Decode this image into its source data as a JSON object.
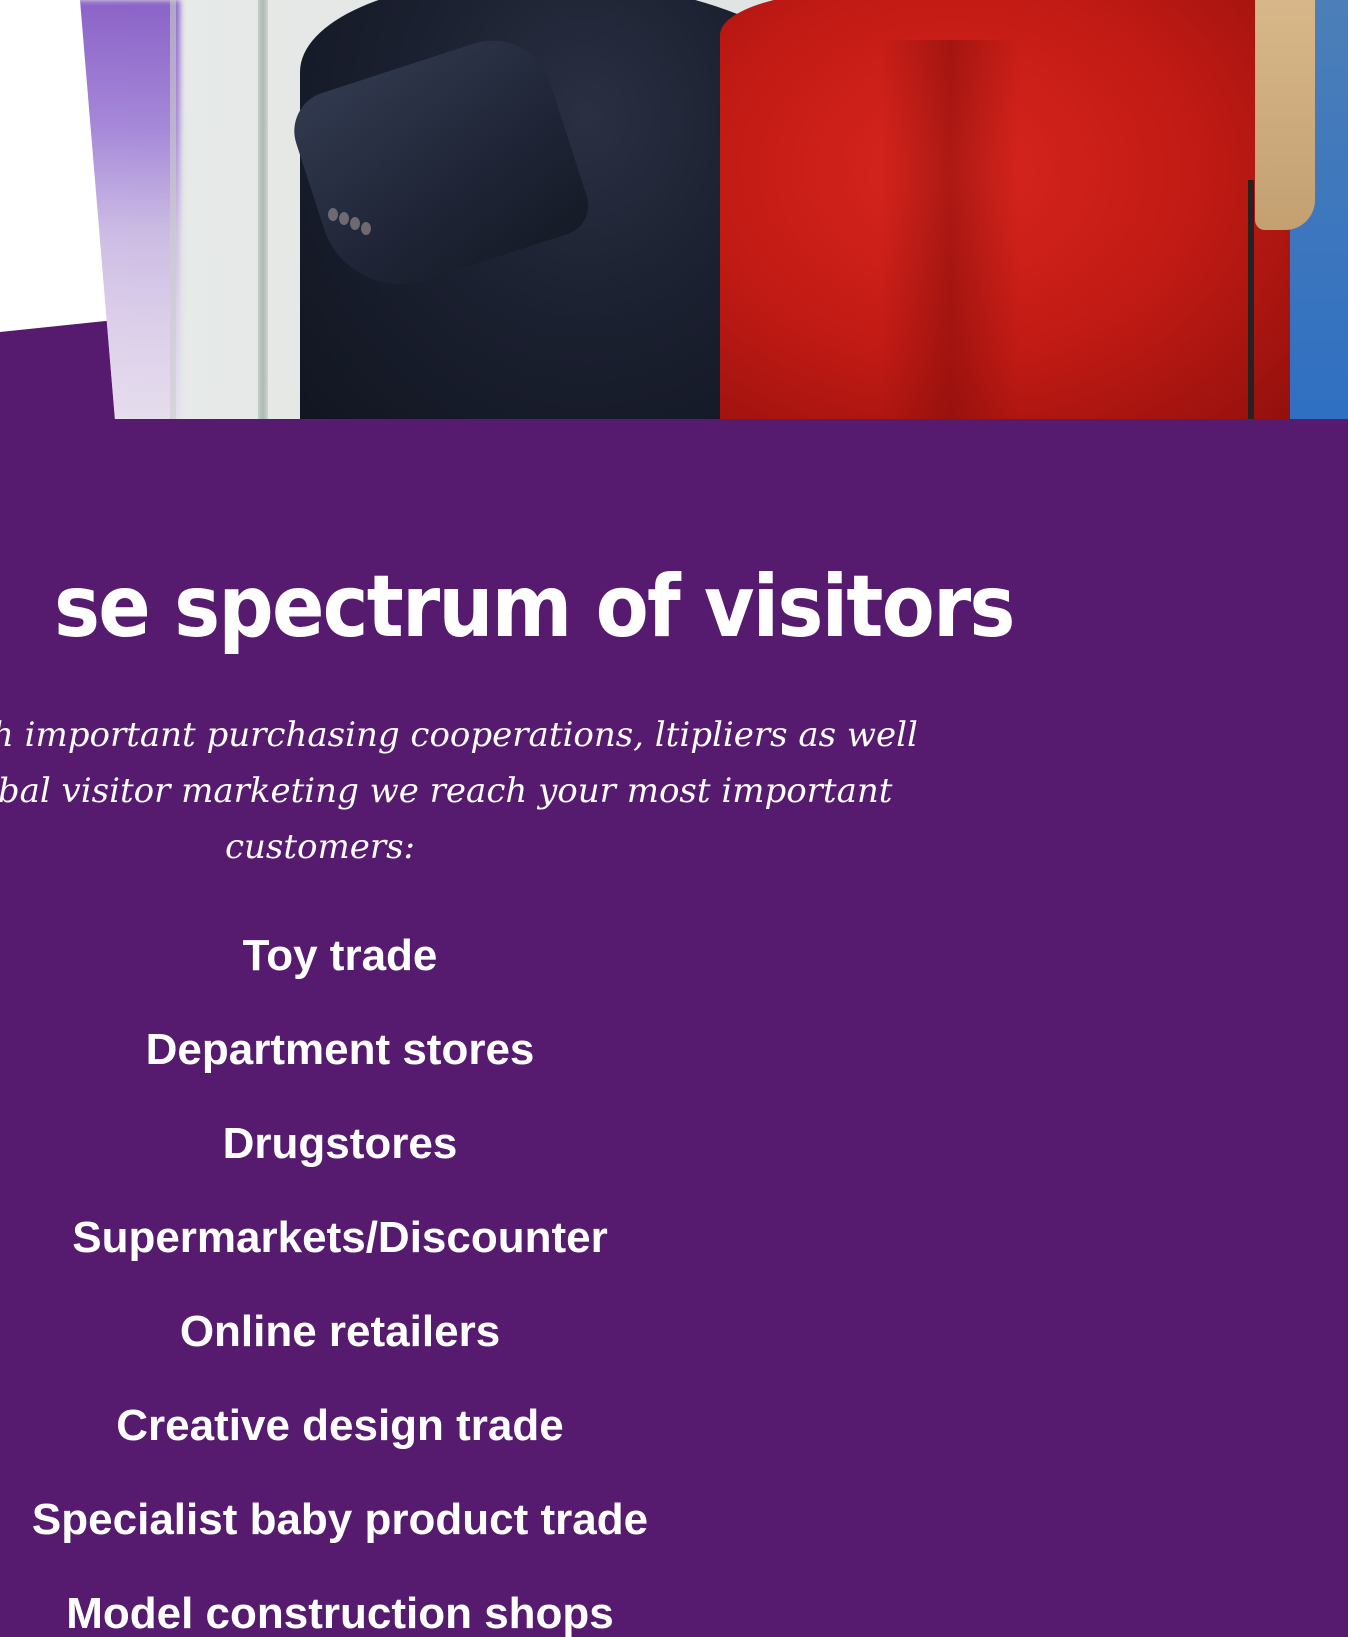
{
  "hero": {
    "image_alt": "Trade fair visitors in conversation"
  },
  "section": {
    "headline": "se spectrum of visitors",
    "intro": "cooperation with important purchasing cooperations, ltipliers as well as through global visitor marketing we reach your most important customers:",
    "visitor_types": [
      "Toy trade",
      "Department stores",
      "Drugstores",
      "Supermarkets/Discounter",
      "Online retailers",
      "Creative design trade",
      "Specialist baby product trade",
      "Model construction shops"
    ]
  },
  "colors": {
    "section_background": "#561b6e",
    "text": "#ffffff"
  }
}
